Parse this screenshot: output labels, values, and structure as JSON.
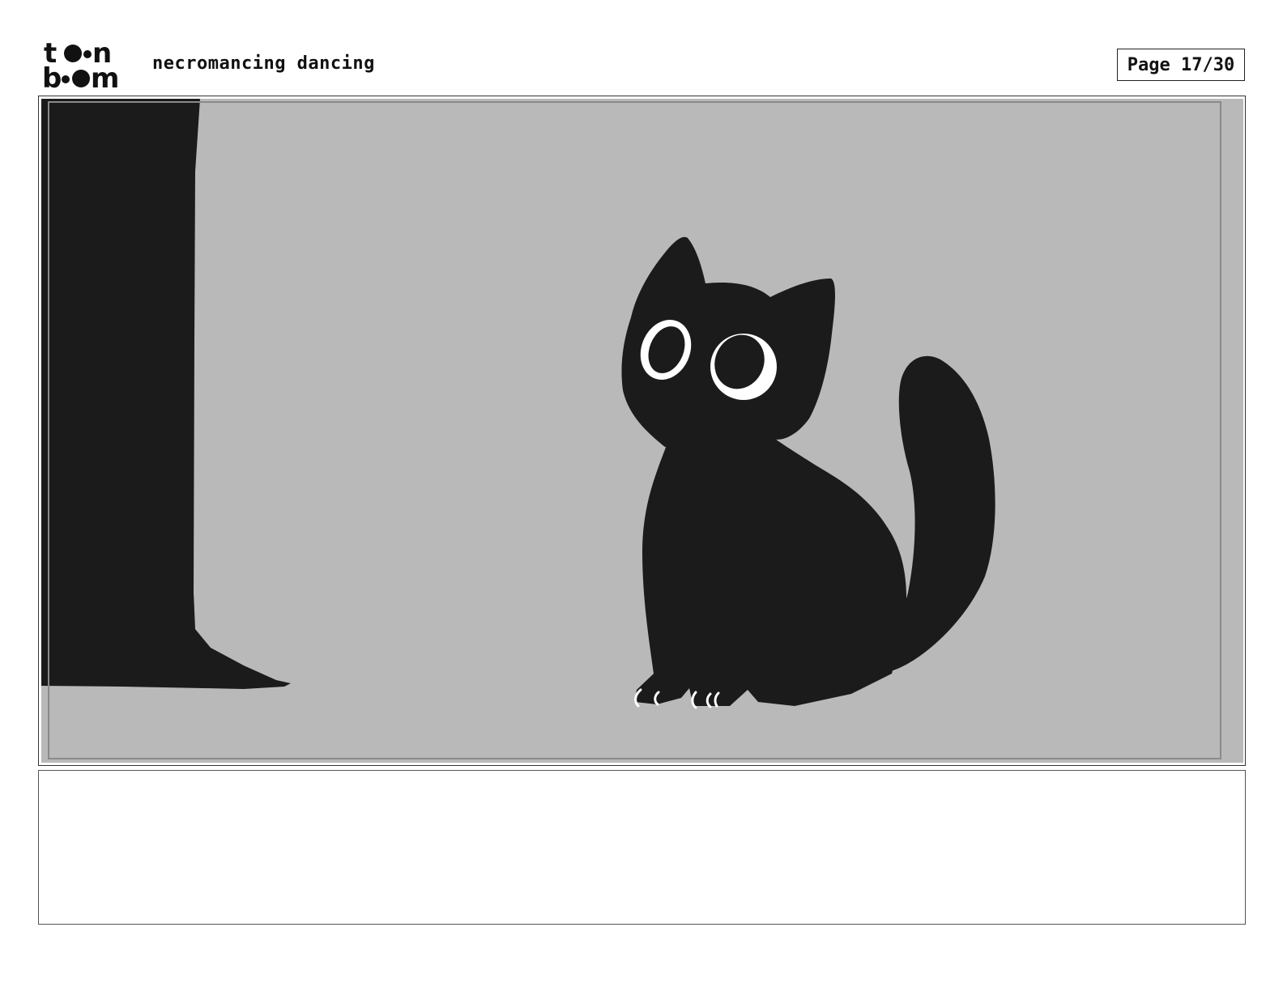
{
  "header": {
    "logo_text": "toon boom",
    "project_title": "necromancing dancing",
    "page_label": "Page 17/30"
  },
  "panel": {
    "background_color": "#b9b9b9",
    "figure_color": "#1b1b1b",
    "eye_color": "#ffffff"
  },
  "notes": {
    "text": ""
  }
}
